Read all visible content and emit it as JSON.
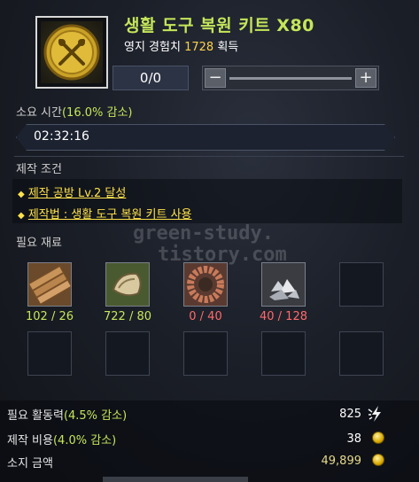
{
  "item": {
    "title": "생활 도구 복원 키트 X80",
    "exp_label": "영지 경험치",
    "exp_value": "1728",
    "exp_suffix": "획득",
    "icon": "tool-kit-gold-icon"
  },
  "quantity": {
    "value": "0/0",
    "minus": "−",
    "plus": "+"
  },
  "time": {
    "label": "소요 시간",
    "reduction": "(16.0% 감소)",
    "value": "02:32:16"
  },
  "conditions": {
    "header": "제작 조건",
    "items": [
      {
        "text": "제작 공방 Lv.2 달성"
      },
      {
        "text": "제작법 : 생활 도구 복원 키트 사용"
      }
    ]
  },
  "materials": {
    "header": "필요 재료",
    "items": [
      {
        "icon": "timber-icon",
        "count": "102 / 26",
        "status": "ok"
      },
      {
        "icon": "tender-timber-icon",
        "count": "722 / 80",
        "status": "ok"
      },
      {
        "icon": "gear-part-icon",
        "count": "0 / 40",
        "status": "bad"
      },
      {
        "icon": "ore-pile-icon",
        "count": "40 / 128",
        "status": "bad"
      }
    ]
  },
  "costs": {
    "energy_label": "필요 활동력",
    "energy_reduction": "(4.5% 감소)",
    "energy_value": "825",
    "fee_label": "제작 비용",
    "fee_reduction": "(4.0% 감소)",
    "fee_value": "38",
    "gold_label": "소지 금액",
    "gold_value": "49,899"
  },
  "watermark": {
    "line1": "green-study.",
    "line2": "tistory.com"
  },
  "colors": {
    "accent_green": "#c5e65a",
    "gold": "#ffd24a",
    "warning_red": "#ff6a6a"
  }
}
